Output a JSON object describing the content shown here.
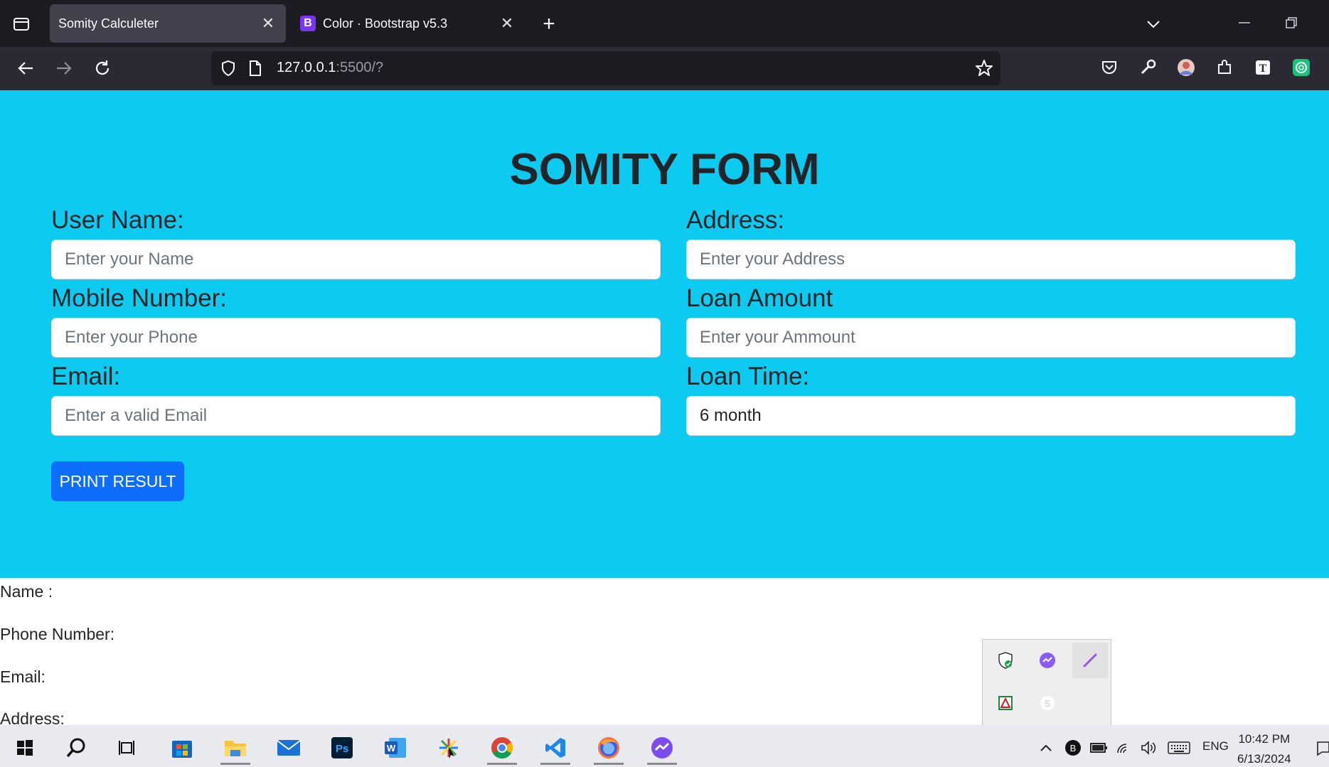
{
  "browser": {
    "tabs": [
      {
        "title": "Somity Calculeter",
        "active": true
      },
      {
        "title": "Color · Bootstrap v5.3",
        "active": false,
        "favicon_letter": "B"
      }
    ],
    "url_host": "127.0.0.1",
    "url_rest": ":5500/?"
  },
  "form": {
    "title": "SOMITY FORM",
    "fields": {
      "user_name": {
        "label": "User Name:",
        "placeholder": "Enter your Name"
      },
      "address": {
        "label": "Address:",
        "placeholder": "Enter your Address"
      },
      "mobile": {
        "label": "Mobile Number:",
        "placeholder": "Enter your Phone"
      },
      "loan_amount": {
        "label": "Loan Amount",
        "placeholder": "Enter your Ammount"
      },
      "email": {
        "label": "Email:",
        "placeholder": "Enter a valid Email"
      },
      "loan_time": {
        "label": "Loan Time:",
        "value": "6 month"
      }
    },
    "print_button": "PRINT RESULT"
  },
  "result": {
    "name": "Name :",
    "phone": "Phone Number:",
    "email": "Email:",
    "address": "Address:"
  },
  "taskbar": {
    "language": "ENG",
    "time": "10:42 PM",
    "date": "6/13/2024"
  },
  "colors": {
    "hero_bg": "#0dcaf0",
    "primary_button": "#0d6efd",
    "text": "#212529"
  }
}
